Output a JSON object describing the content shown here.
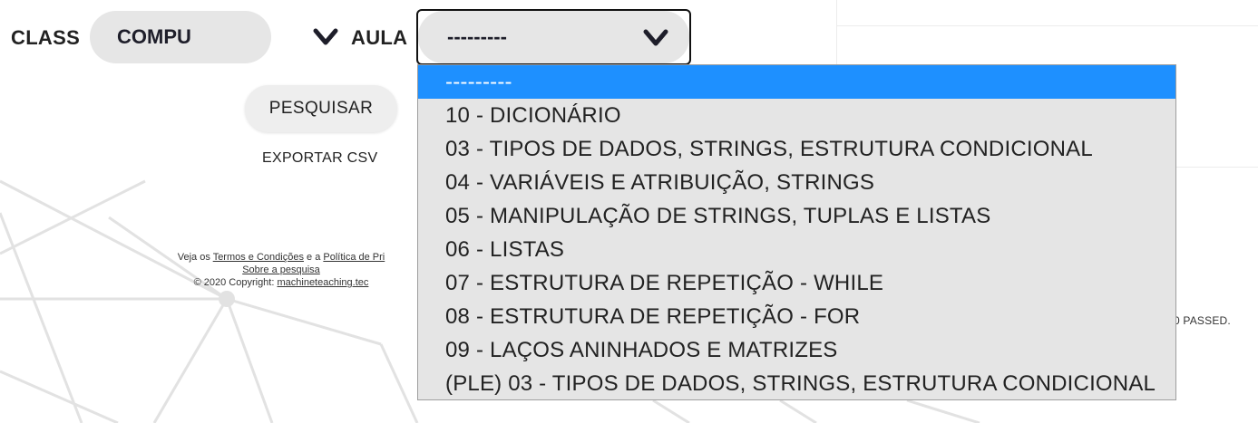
{
  "filters": {
    "class_label": "CLASS",
    "class_value": "COMPU",
    "aula_label": "AULA",
    "aula_value": "---------"
  },
  "actions": {
    "search_label": "PESQUISAR",
    "export_label": "EXPORTAR CSV"
  },
  "footer": {
    "line1_prefix": "Veja os ",
    "terms_link": "Termos e Condições",
    "line1_mid": " e a ",
    "privacy_link": "Política de Pri",
    "about_link": "Sobre a pesquisa",
    "copyright_prefix": "© 2020 Copyright: ",
    "site_link": "machineteaching.tec"
  },
  "right_panel": {
    "passed_text": "0 PASSED."
  },
  "dropdown": {
    "options": [
      "---------",
      "10 - DICIONÁRIO",
      "03 - TIPOS DE DADOS, STRINGS, ESTRUTURA CONDICIONAL",
      "04 - VARIÁVEIS E ATRIBUIÇÃO, STRINGS",
      "05 - MANIPULAÇÃO DE STRINGS, TUPLAS E LISTAS",
      "06 - LISTAS",
      "07 - ESTRUTURA DE REPETIÇÃO - WHILE",
      "08 - ESTRUTURA DE REPETIÇÃO - FOR",
      "09 - LAÇOS ANINHADOS E MATRIZES",
      "(PLE) 03 - TIPOS DE DADOS, STRINGS, ESTRUTURA CONDICIONAL"
    ],
    "selected_index": 0
  },
  "colors": {
    "highlight": "#1e90ff",
    "pill": "#e6e6e6",
    "dropdown_bg": "#e5e5e5"
  }
}
